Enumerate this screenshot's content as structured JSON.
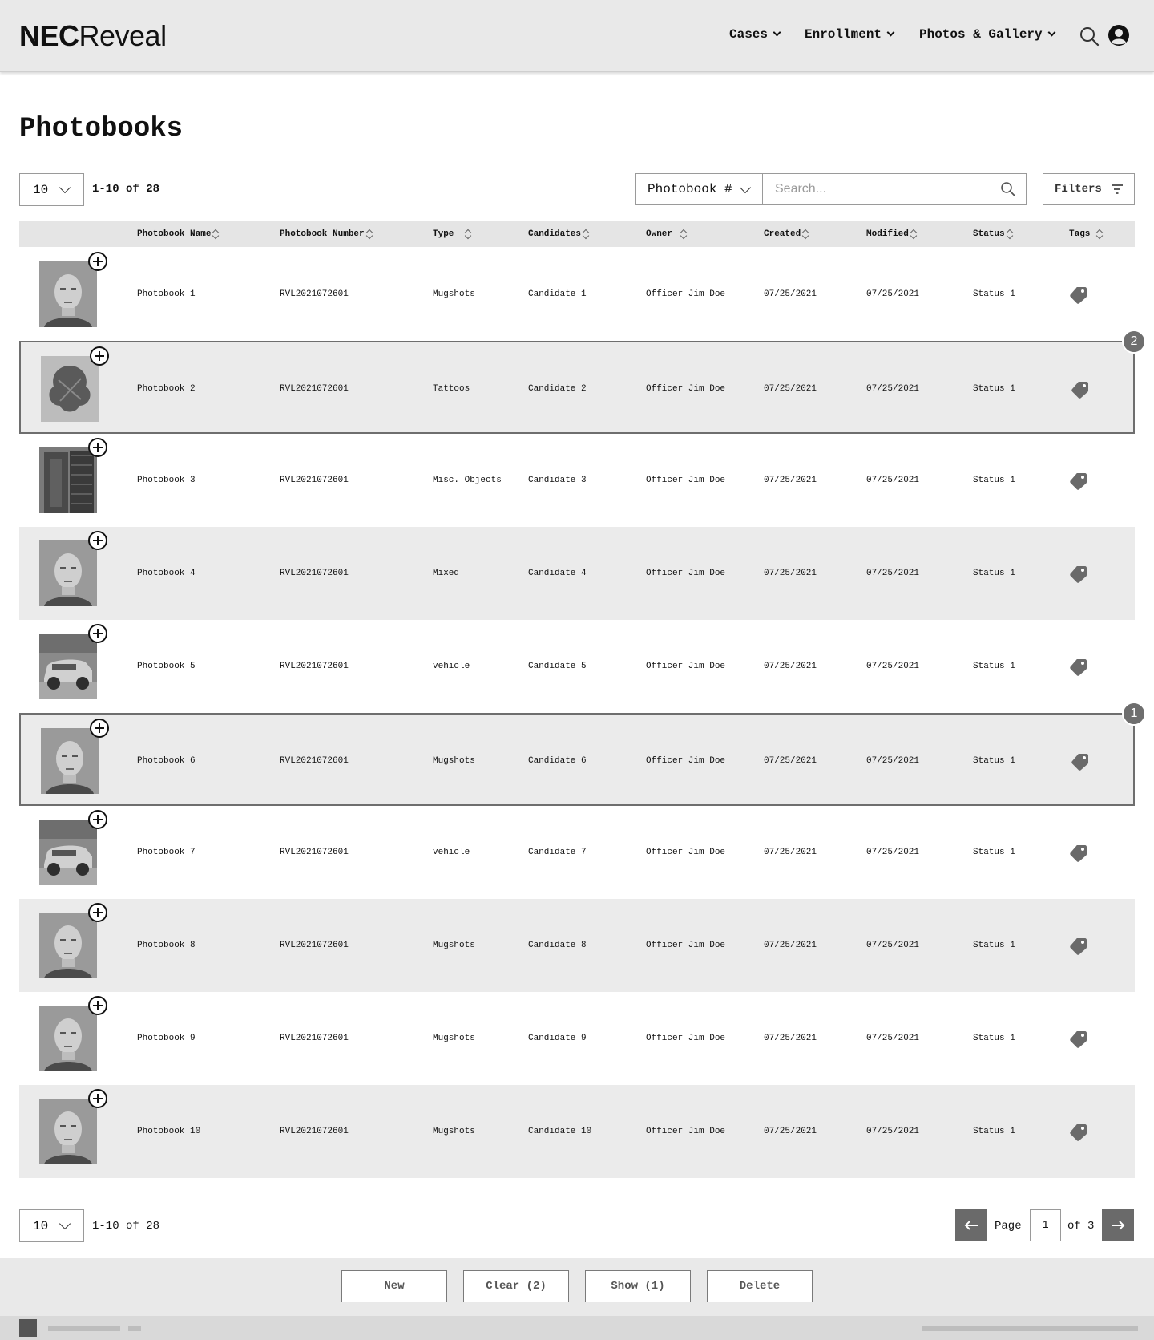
{
  "header": {
    "logo_bold": "NEC",
    "logo_light": "Reveal",
    "nav": [
      {
        "label": "Cases"
      },
      {
        "label": "Enrollment"
      },
      {
        "label": "Photos & Gallery"
      }
    ]
  },
  "page": {
    "title": "Photobooks"
  },
  "controls": {
    "per_page": "10",
    "range": "1-10 of 28",
    "search_type": "Photobook #",
    "search_placeholder": "Search...",
    "filters_label": "Filters"
  },
  "table": {
    "columns": [
      "Photobook Name",
      "Photobook Number",
      "Type",
      "Candidates",
      "Owner",
      "Created",
      "Modified",
      "Status",
      "Tags"
    ],
    "rows": [
      {
        "name": "Photobook 1",
        "number": "RVL2021072601",
        "type": "Mugshots",
        "candidate": "Candidate 1",
        "owner": "Officer Jim Doe",
        "created": "07/25/2021",
        "modified": "07/25/2021",
        "status": "Status 1",
        "thumb": "face"
      },
      {
        "name": "Photobook 2",
        "number": "RVL2021072601",
        "type": "Tattoos",
        "candidate": "Candidate 2",
        "owner": "Officer Jim Doe",
        "created": "07/25/2021",
        "modified": "07/25/2021",
        "status": "Status 1",
        "thumb": "tattoo",
        "selection_badge": "2"
      },
      {
        "name": "Photobook 3",
        "number": "RVL2021072601",
        "type": "Misc. Objects",
        "candidate": "Candidate 3",
        "owner": "Officer Jim Doe",
        "created": "07/25/2021",
        "modified": "07/25/2021",
        "status": "Status 1",
        "thumb": "object"
      },
      {
        "name": "Photobook 4",
        "number": "RVL2021072601",
        "type": "Mixed",
        "candidate": "Candidate 4",
        "owner": "Officer Jim Doe",
        "created": "07/25/2021",
        "modified": "07/25/2021",
        "status": "Status 1",
        "thumb": "face"
      },
      {
        "name": "Photobook 5",
        "number": "RVL2021072601",
        "type": "vehicle",
        "candidate": "Candidate 5",
        "owner": "Officer Jim Doe",
        "created": "07/25/2021",
        "modified": "07/25/2021",
        "status": "Status 1",
        "thumb": "vehicle"
      },
      {
        "name": "Photobook 6",
        "number": "RVL2021072601",
        "type": "Mugshots",
        "candidate": "Candidate 6",
        "owner": "Officer Jim Doe",
        "created": "07/25/2021",
        "modified": "07/25/2021",
        "status": "Status 1",
        "thumb": "face",
        "selection_badge": "1"
      },
      {
        "name": "Photobook 7",
        "number": "RVL2021072601",
        "type": "vehicle",
        "candidate": "Candidate 7",
        "owner": "Officer Jim Doe",
        "created": "07/25/2021",
        "modified": "07/25/2021",
        "status": "Status 1",
        "thumb": "vehicle"
      },
      {
        "name": "Photobook 8",
        "number": "RVL2021072601",
        "type": "Mugshots",
        "candidate": "Candidate 8",
        "owner": "Officer Jim Doe",
        "created": "07/25/2021",
        "modified": "07/25/2021",
        "status": "Status 1",
        "thumb": "face"
      },
      {
        "name": "Photobook 9",
        "number": "RVL2021072601",
        "type": "Mugshots",
        "candidate": "Candidate 9",
        "owner": "Officer Jim Doe",
        "created": "07/25/2021",
        "modified": "07/25/2021",
        "status": "Status 1",
        "thumb": "face"
      },
      {
        "name": "Photobook 10",
        "number": "RVL2021072601",
        "type": "Mugshots",
        "candidate": "Candidate 10",
        "owner": "Officer Jim Doe",
        "created": "07/25/2021",
        "modified": "07/25/2021",
        "status": "Status 1",
        "thumb": "face"
      }
    ]
  },
  "pagination": {
    "per_page": "10",
    "range": "1-10 of 28",
    "page_label": "Page",
    "page": "1",
    "of_label": "of",
    "total_pages": "3"
  },
  "actions": {
    "new": "New",
    "clear": "Clear (2)",
    "show": "Show (1)",
    "delete": "Delete"
  },
  "colors": {
    "header_bg": "#e9e9e9",
    "row_shade": "#ebebeb",
    "accent_dark": "#6a6a6a"
  }
}
